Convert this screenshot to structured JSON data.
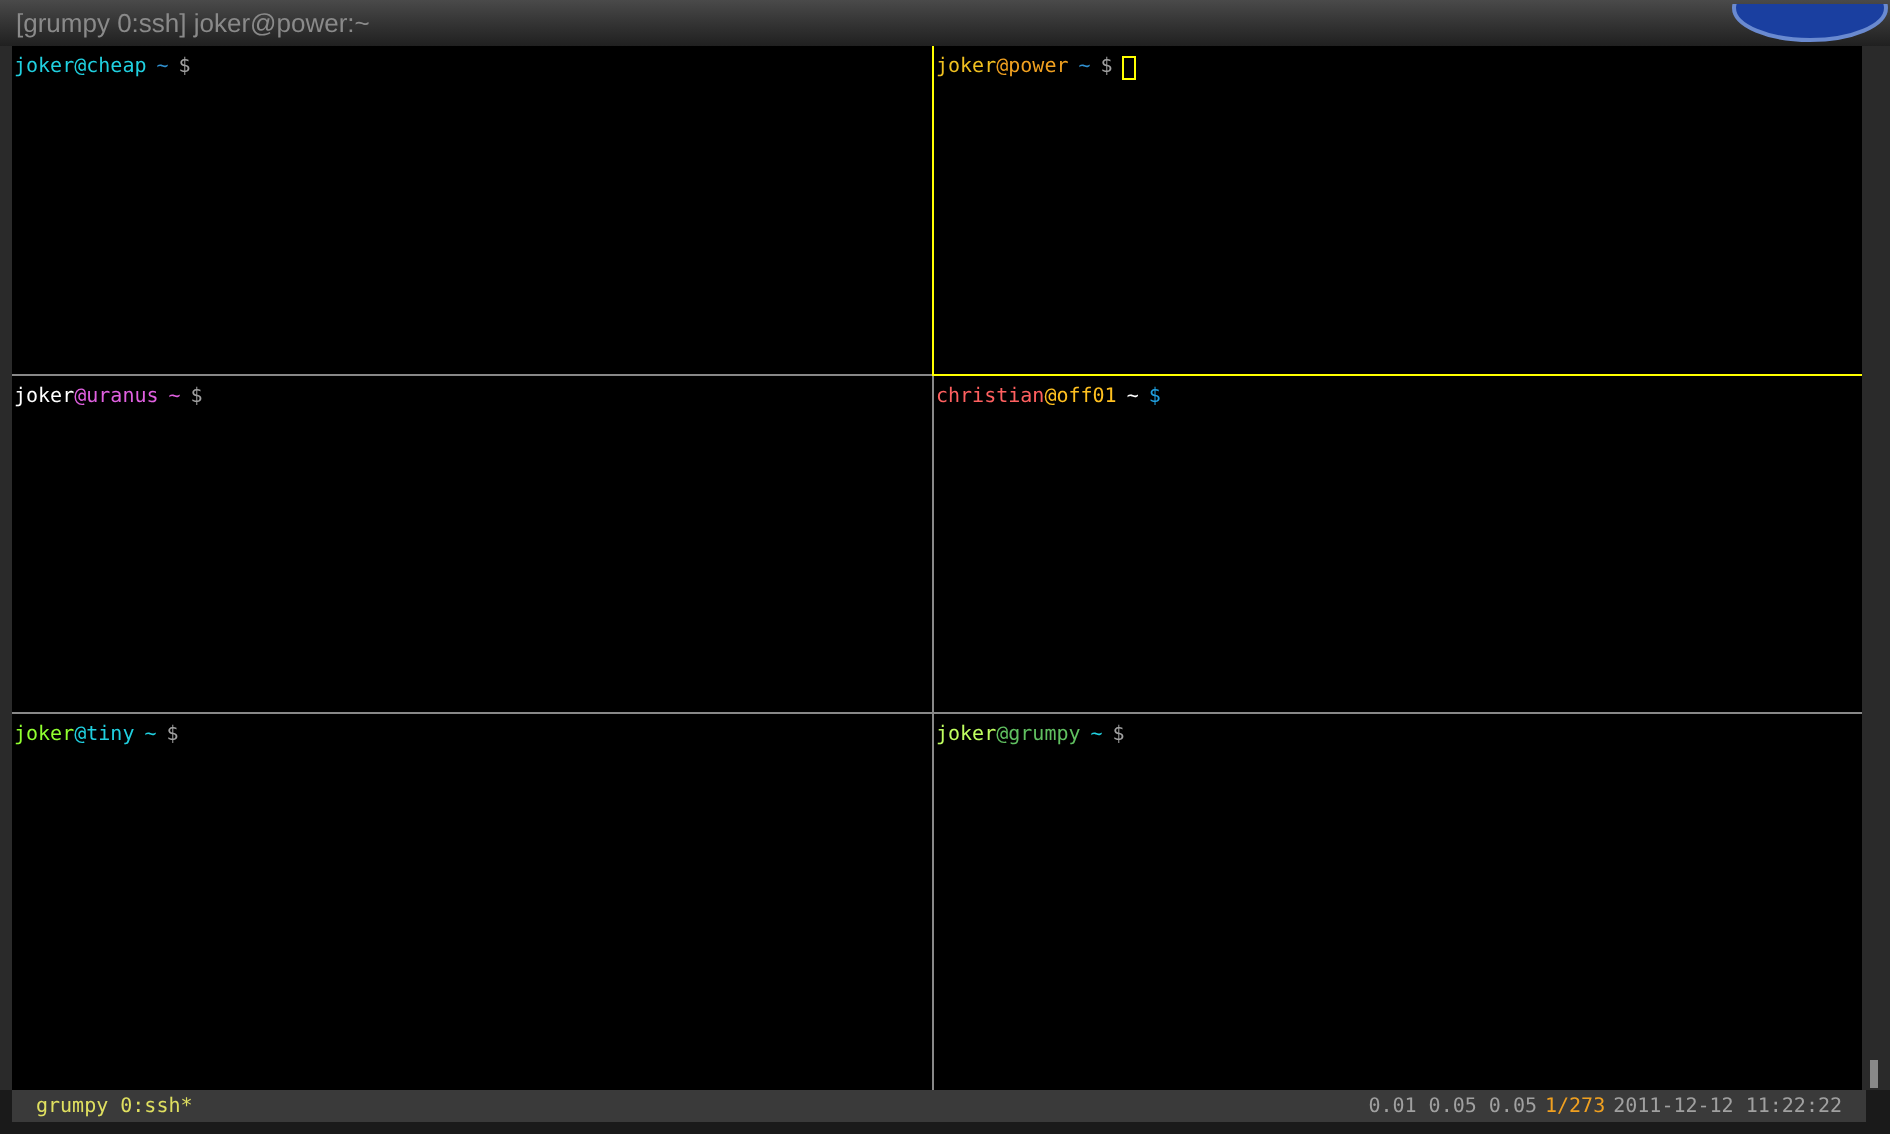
{
  "window": {
    "title": "[grumpy 0:ssh] joker@power:~"
  },
  "panes": [
    {
      "active": false,
      "prompt": [
        {
          "text": "joker",
          "color": "#20d0e0"
        },
        {
          "text": "@cheap",
          "color": "#20d0e0"
        },
        {
          "text": "~",
          "color": "#3090d0"
        },
        {
          "text": "$",
          "color": "#a0a0a0"
        }
      ]
    },
    {
      "active": true,
      "prompt": [
        {
          "text": "joker",
          "color": "#f0c020"
        },
        {
          "text": "@power",
          "color": "#f0a020"
        },
        {
          "text": "~",
          "color": "#3090d0"
        },
        {
          "text": "$",
          "color": "#a0a0a0"
        }
      ]
    },
    {
      "active": false,
      "prompt": [
        {
          "text": "joker",
          "color": "#ffffff"
        },
        {
          "text": "@uranus",
          "color": "#e060e0"
        },
        {
          "text": "~",
          "color": "#e060e0"
        },
        {
          "text": "$",
          "color": "#a0a0a0"
        }
      ]
    },
    {
      "active": false,
      "prompt": [
        {
          "text": "christian",
          "color": "#ff6060"
        },
        {
          "text": "@off01",
          "color": "#ffc020"
        },
        {
          "text": "~",
          "color": "#ffffff"
        },
        {
          "text": "$",
          "color": "#20a0e0"
        }
      ]
    },
    {
      "active": false,
      "prompt": [
        {
          "text": "joker",
          "color": "#90ff30"
        },
        {
          "text": "@tiny",
          "color": "#20d0e0"
        },
        {
          "text": "~",
          "color": "#20d0e0"
        },
        {
          "text": "$",
          "color": "#a0a0a0"
        }
      ]
    },
    {
      "active": false,
      "prompt": [
        {
          "text": "joker",
          "color": "#c0ff60"
        },
        {
          "text": "@grumpy",
          "color": "#60c060"
        },
        {
          "text": "~",
          "color": "#20d0e0"
        },
        {
          "text": "$",
          "color": "#a0a0a0"
        }
      ]
    }
  ],
  "status_bar": {
    "window_list": "grumpy 0:ssh*",
    "load": "0.01 0.05 0.05",
    "counter": "1/273",
    "datetime": "2011-12-12 11:22:22"
  }
}
